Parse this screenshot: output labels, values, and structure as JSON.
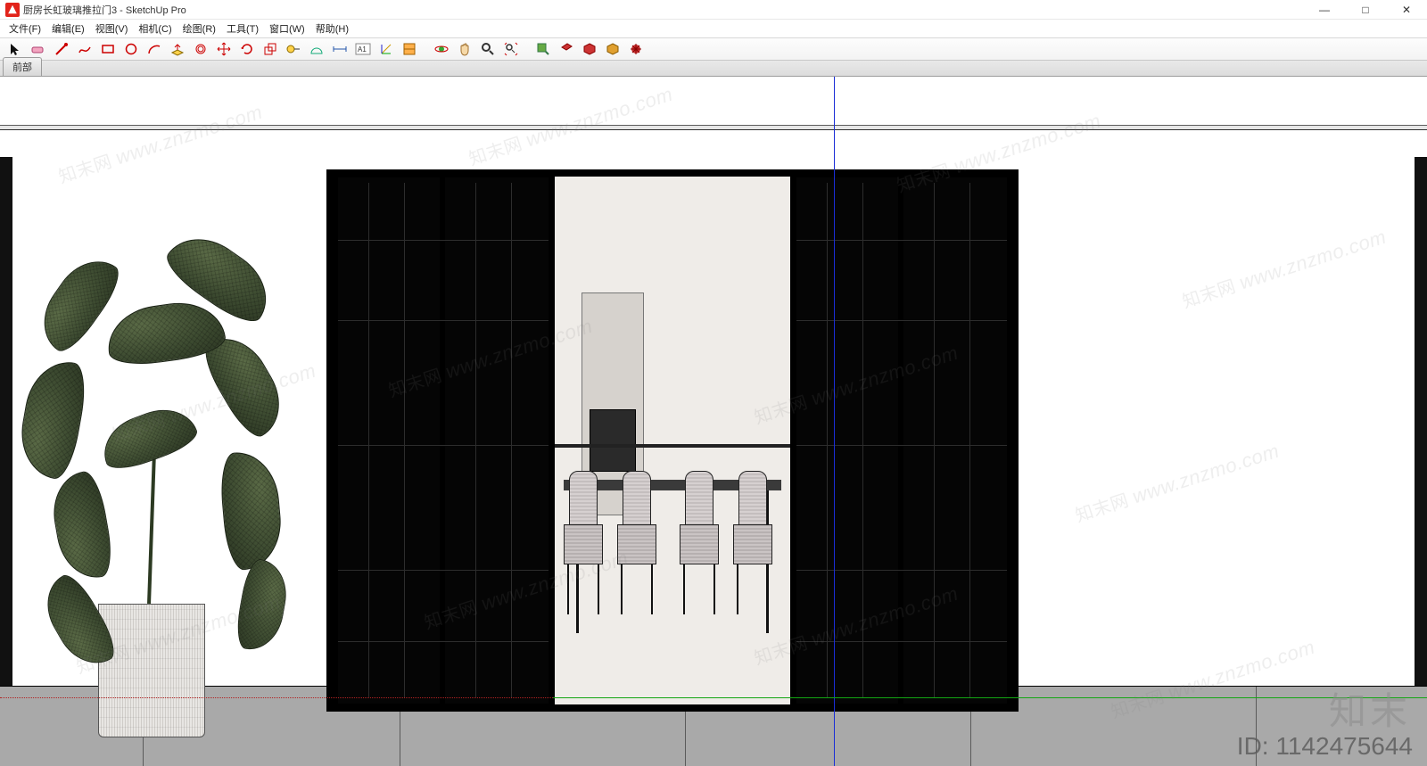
{
  "window": {
    "title": "厨房长虹玻璃推拉门3 - SketchUp Pro",
    "min": "—",
    "max": "□",
    "close": "✕"
  },
  "menu": {
    "file": "文件(F)",
    "edit": "编辑(E)",
    "view": "视图(V)",
    "camera": "相机(C)",
    "draw": "绘图(R)",
    "tools": "工具(T)",
    "window": "窗口(W)",
    "help": "帮助(H)"
  },
  "scene": {
    "tab1": "前部"
  },
  "toolbar_icons": [
    "select",
    "eraser",
    "line",
    "freehand",
    "rectangle",
    "circle",
    "arc",
    "push-pull",
    "offset",
    "move",
    "rotate",
    "scale",
    "tape",
    "protractor",
    "dimension",
    "text",
    "axes",
    "section",
    "orbit",
    "pan",
    "zoom",
    "zoom-extents",
    "paint",
    "sample",
    "material",
    "texture",
    "explode"
  ],
  "watermark": {
    "cn": "知末网",
    "url": "www.znzmo.com"
  },
  "brand": "知末",
  "id_label": "ID: 1142475644"
}
